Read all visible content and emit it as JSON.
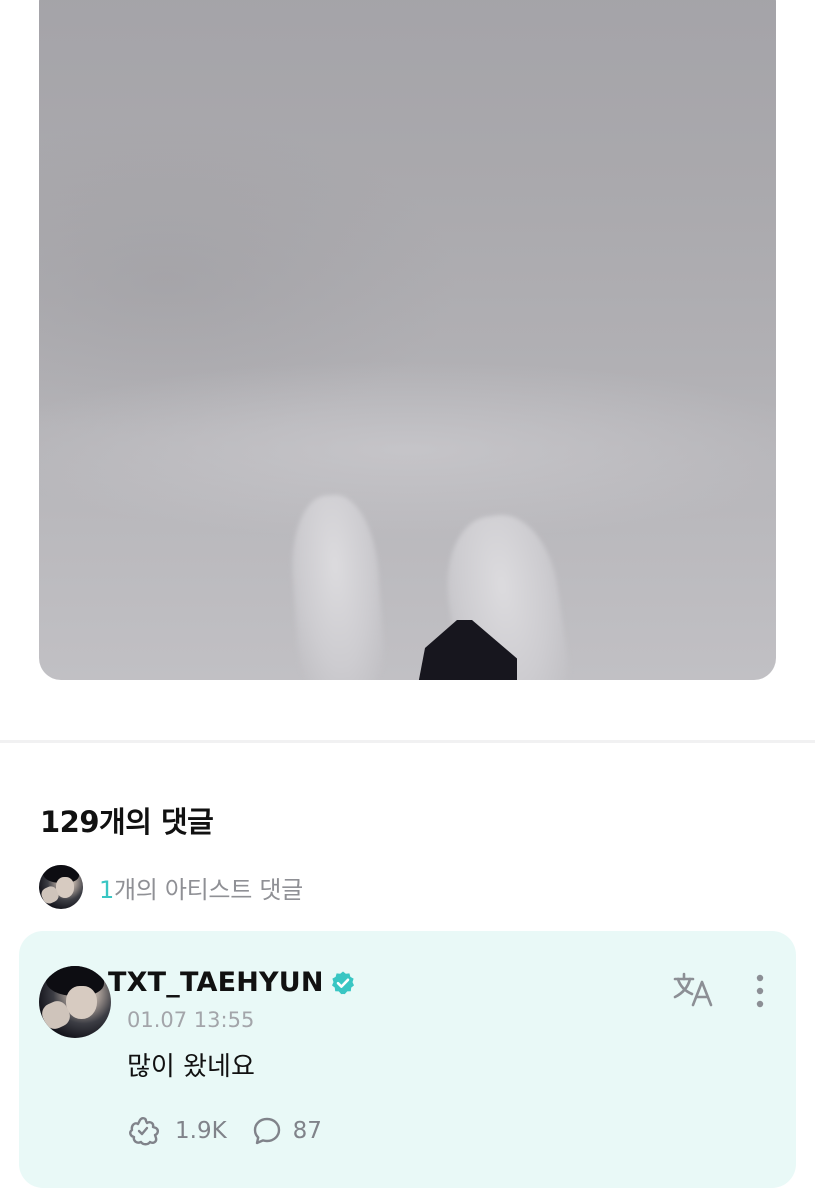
{
  "post": {
    "image": "snowy-ground-photo"
  },
  "comments": {
    "count_text": "129개의 댓글",
    "artist_summary": {
      "count": "1",
      "suffix": "개의 아티스트 댓글"
    },
    "artist_comment": {
      "username": "TXT_TAEHYUN",
      "verified": true,
      "timestamp": "01.07 13:55",
      "text": "많이 왔네요",
      "likes": "1.9K",
      "replies": "87"
    }
  },
  "icons": {
    "verified": "verified-badge-icon",
    "translate": "translate-icon",
    "more": "more-vertical-icon",
    "like": "like-hands-icon",
    "reply": "comment-bubble-icon"
  },
  "colors": {
    "accent": "#39c6c3",
    "card_background": "#e9f9f7",
    "secondary_text": "#8f9095"
  }
}
